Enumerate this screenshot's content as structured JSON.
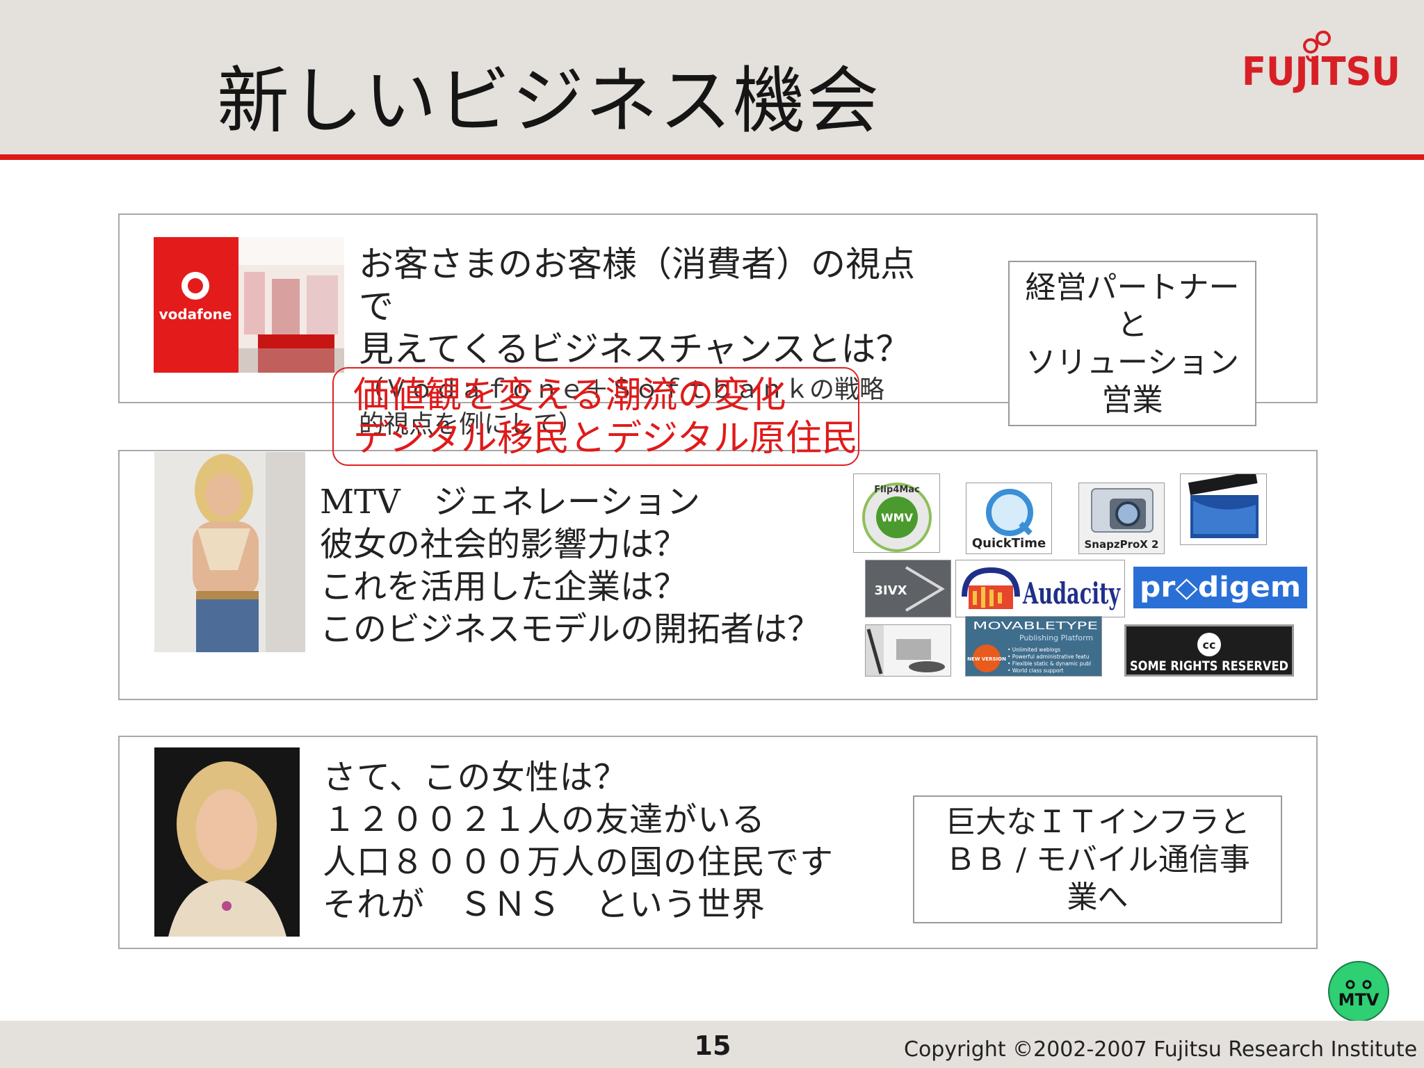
{
  "slide": {
    "title": "新しいビジネス機会",
    "logo_text": "FUJITSU",
    "page_number": "15",
    "copyright": "Copyright ©2002-2007 Fujitsu Research Institute"
  },
  "panel1": {
    "photo_brand": "vodafone",
    "lines": [
      "お客さまのお客様（消費者）の視点",
      "で",
      "見えてくるビジネスチャンスとは？"
    ],
    "note_lines": [
      "（Ｖｏｄａｆｏｎｅ＋Ｓｏｆｔｂａｎｋの戦略",
      "的視点を例にして）"
    ],
    "callout_lines": [
      "経営パートナー",
      "と",
      "ソリューション",
      "営業"
    ]
  },
  "red_callout": {
    "lines": [
      "価値観を変える潮流の変化",
      "デジタル移民とデジタル原住民"
    ],
    "color": "#e01a1a"
  },
  "panel2": {
    "lines": [
      "MTV　ジェネレーション",
      "彼女の社会的影響力は？",
      "これを活用した企業は？",
      "このビジネスモデルの開拓者は？"
    ],
    "icons": {
      "flip4mac_title": "Flip4Mac",
      "flip4mac_badge": "WMV",
      "quicktime": "QuickTime",
      "snapzprox": "SnapzProX 2",
      "threeivx": "3IVX",
      "audacity": "Audacity",
      "prodigem": "pr◇digem",
      "movabletype_title": "MOVABLETYPE",
      "movabletype_sub": "Publishing Platform",
      "movabletype_badge": "NEW VERSION",
      "movabletype_bullets": [
        "• Unlimited weblogs",
        "• Powerful administrative featu",
        "• Flexible static & dynamic publ",
        "• World class support"
      ],
      "cc_symbol": "cc",
      "cc_text": "SOME RIGHTS RESERVED"
    }
  },
  "panel3": {
    "lines": [
      "さて、この女性は？",
      "１２００２１人の友達がいる",
      "人口８０００万人の国の住民です",
      "それが　ＳＮＳ　という世界"
    ],
    "callout_lines": [
      "巨大なＩＴインフラと",
      "ＢＢ / モバイル通信事",
      "業へ"
    ]
  },
  "mtv_badge": "MTV",
  "colors": {
    "accent_red": "#e01818",
    "header_bg": "#e4e0dc",
    "badge_green": "#2fcf74"
  }
}
